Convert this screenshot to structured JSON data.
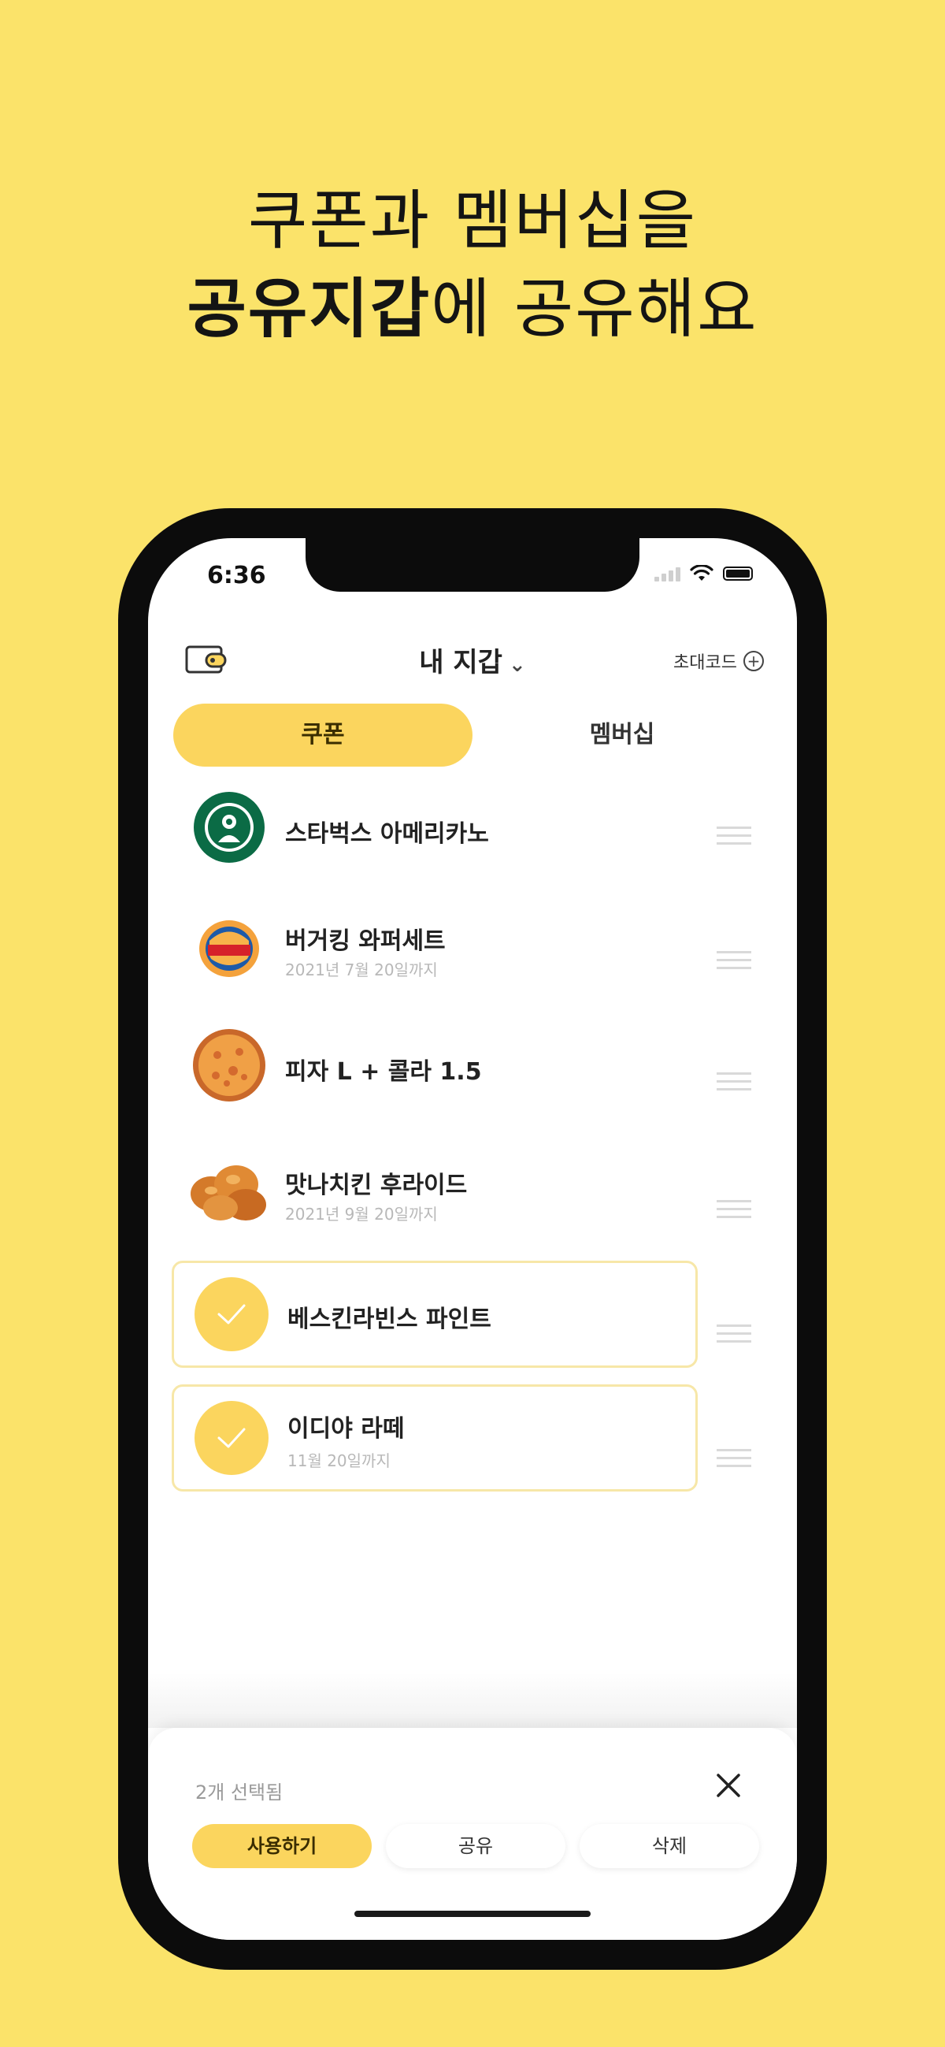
{
  "headline": {
    "line1": "쿠폰과 멤버십을",
    "line2_bold": "공유지갑",
    "line2_rest": "에 공유해요"
  },
  "status_bar": {
    "time": "6:36"
  },
  "header": {
    "wallet_icon": "wallet-icon",
    "title": "내 지갑",
    "title_chevron": "⌄",
    "invite_label": "초대코드",
    "invite_icon": "plus-circle-icon"
  },
  "tabs": [
    {
      "label": "쿠폰",
      "active": true
    },
    {
      "label": "멤버십",
      "active": false
    }
  ],
  "coupons": [
    {
      "title": "스타벅스 아메리카노",
      "subtitle": "",
      "icon": "starbucks-logo",
      "selected": false
    },
    {
      "title": "버거킹 와퍼세트",
      "subtitle": "2021년 7월 20일까지",
      "icon": "burgerking-logo",
      "selected": false
    },
    {
      "title": "피자 L + 콜라 1.5",
      "subtitle": "",
      "icon": "pizza-image",
      "selected": false
    },
    {
      "title": "맛나치킨 후라이드",
      "subtitle": "2021년 9월 20일까지",
      "icon": "chicken-image",
      "selected": false
    },
    {
      "title": "베스킨라빈스 파인트",
      "subtitle": "",
      "icon": "check-icon",
      "selected": true
    },
    {
      "title": "이디야 라떼",
      "subtitle": "11월 20일까지",
      "icon": "check-icon",
      "selected": true
    }
  ],
  "sheet": {
    "selected_count": "2개 선택됨",
    "close_icon": "close-icon",
    "buttons": {
      "use": "사용하기",
      "share": "공유",
      "delete": "삭제"
    }
  },
  "colors": {
    "background": "#FBE36A",
    "accent": "#FBD55E",
    "selected_border": "#F7E7A8"
  }
}
